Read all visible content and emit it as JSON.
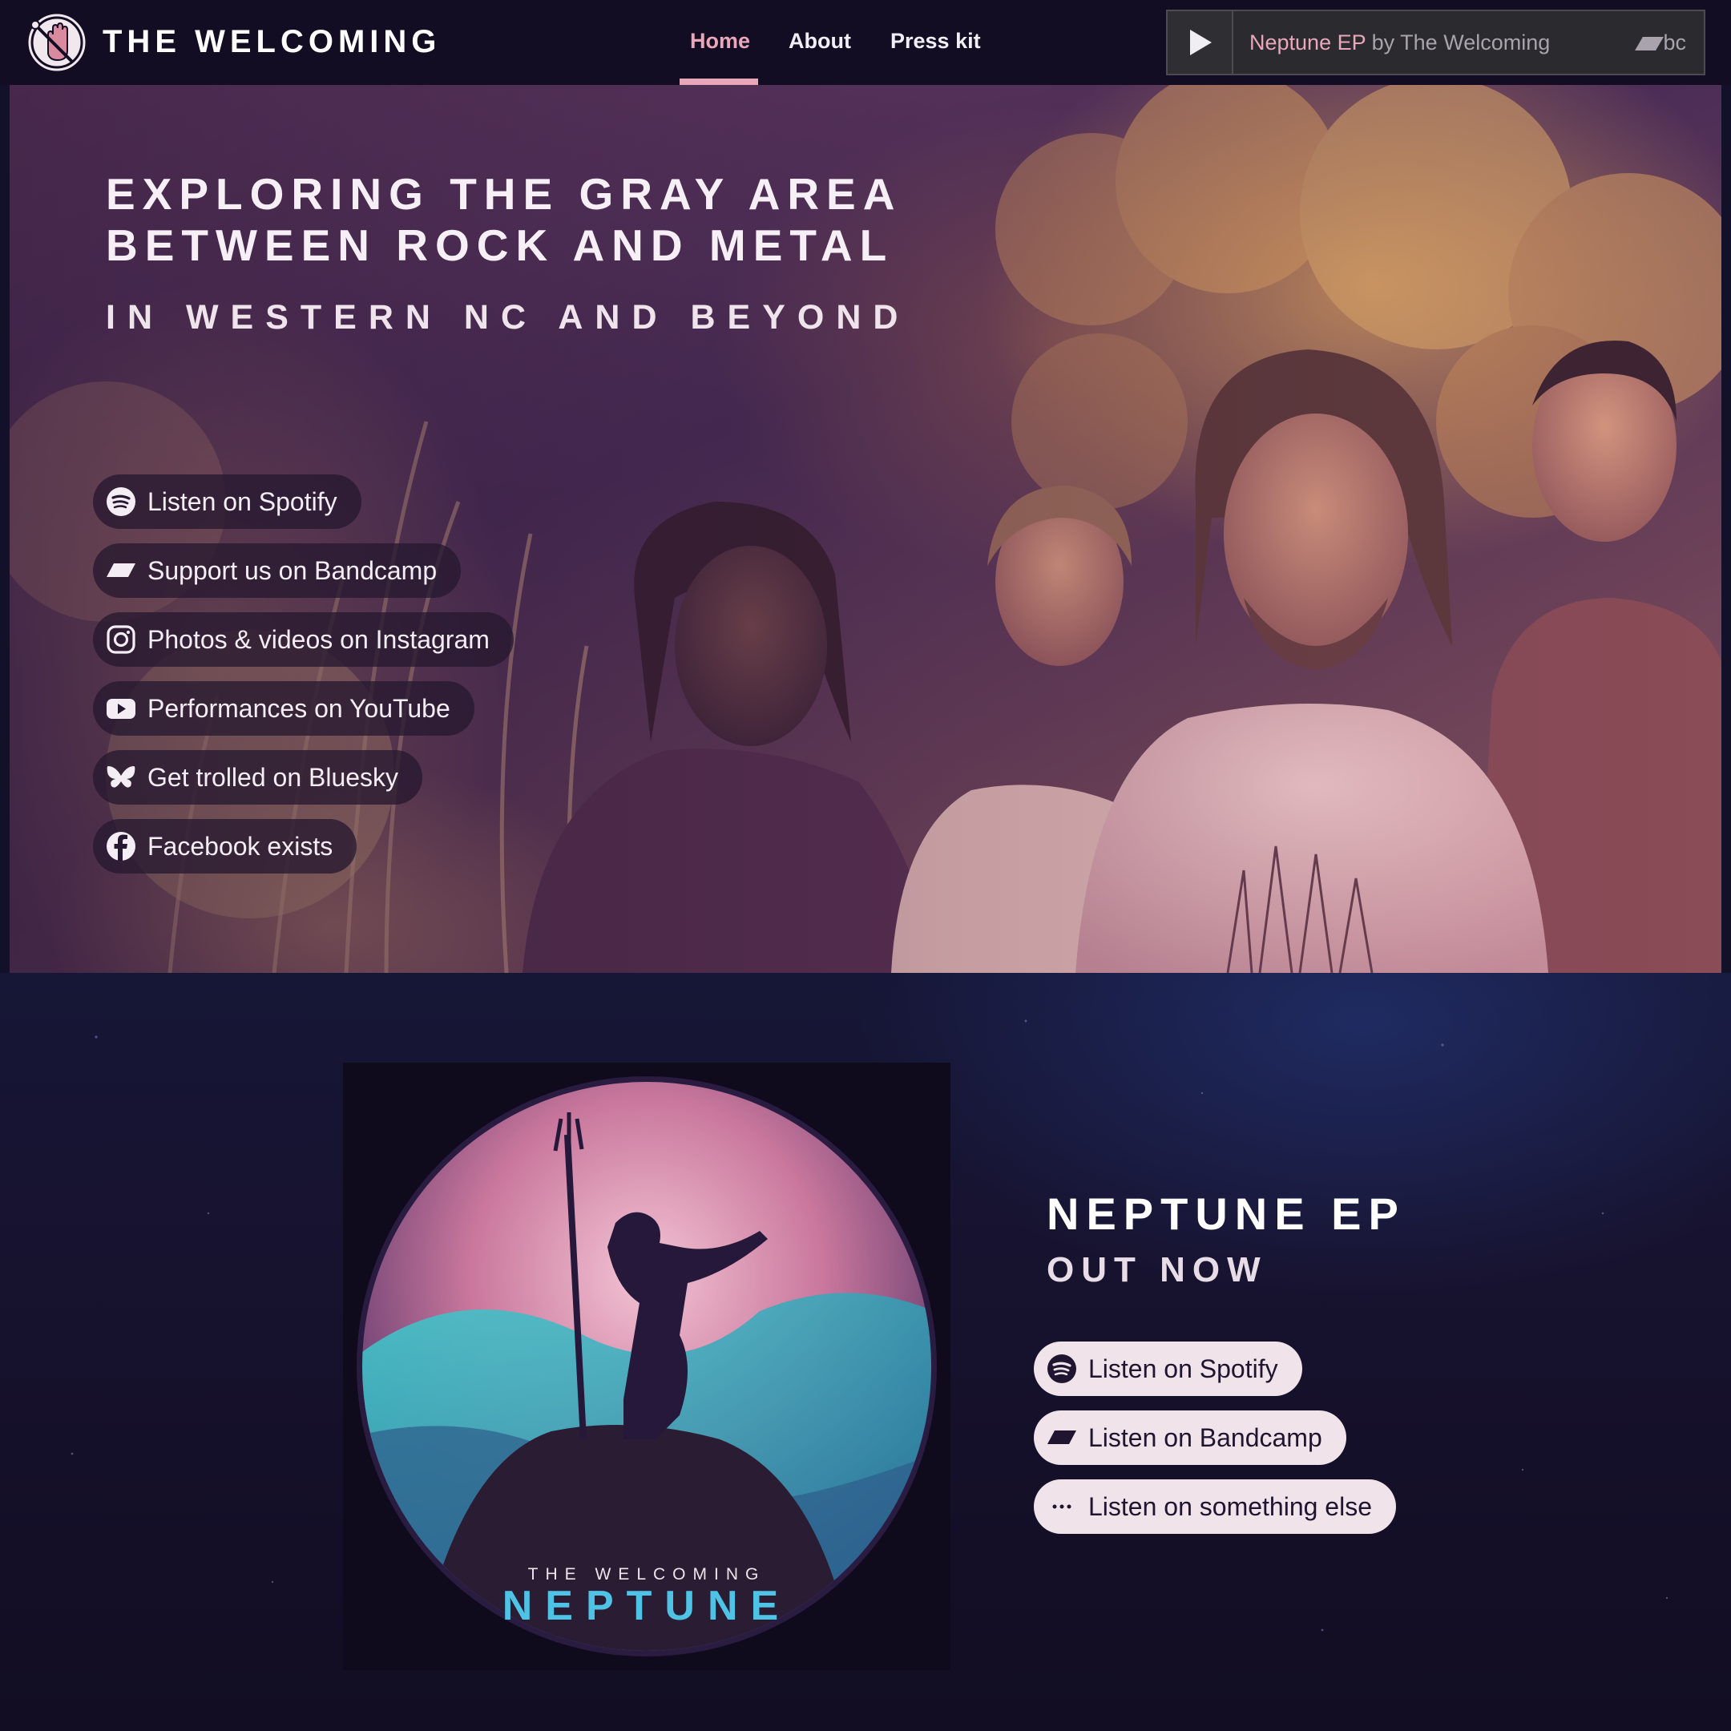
{
  "header": {
    "brand": "THE WELCOMING",
    "nav": [
      "Home",
      "About",
      "Press kit"
    ],
    "active_nav": "Home",
    "player": {
      "album": "Neptune EP",
      "by": "by The Welcoming",
      "bc_label": "bc"
    }
  },
  "hero": {
    "title_line1": "EXPLORING THE GRAY AREA",
    "title_line2": "BETWEEN ROCK AND METAL",
    "subtitle": "IN WESTERN NC AND BEYOND",
    "links": [
      {
        "label": "Listen on Spotify",
        "icon": "spotify-icon"
      },
      {
        "label": "Support us on Bandcamp",
        "icon": "bandcamp-icon"
      },
      {
        "label": "Photos & videos on Instagram",
        "icon": "instagram-icon"
      },
      {
        "label": "Performances on YouTube",
        "icon": "youtube-icon"
      },
      {
        "label": "Get trolled on Bluesky",
        "icon": "bluesky-icon"
      },
      {
        "label": "Facebook exists",
        "icon": "facebook-icon"
      }
    ]
  },
  "release": {
    "title": "NEPTUNE EP",
    "subtitle": "OUT NOW",
    "cover_band": "THE WELCOMING",
    "cover_title": "NEPTUNE",
    "links": [
      {
        "label": "Listen on Spotify",
        "icon": "spotify-icon"
      },
      {
        "label": "Listen on Bandcamp",
        "icon": "bandcamp-icon"
      },
      {
        "label": "Listen on something else",
        "icon": "more-icon"
      }
    ]
  },
  "colors": {
    "accent_pink": "#e9a7b9",
    "header_bg": "#120d22",
    "pill_light": "#f0e4ea",
    "pill_dark": "#261830"
  }
}
